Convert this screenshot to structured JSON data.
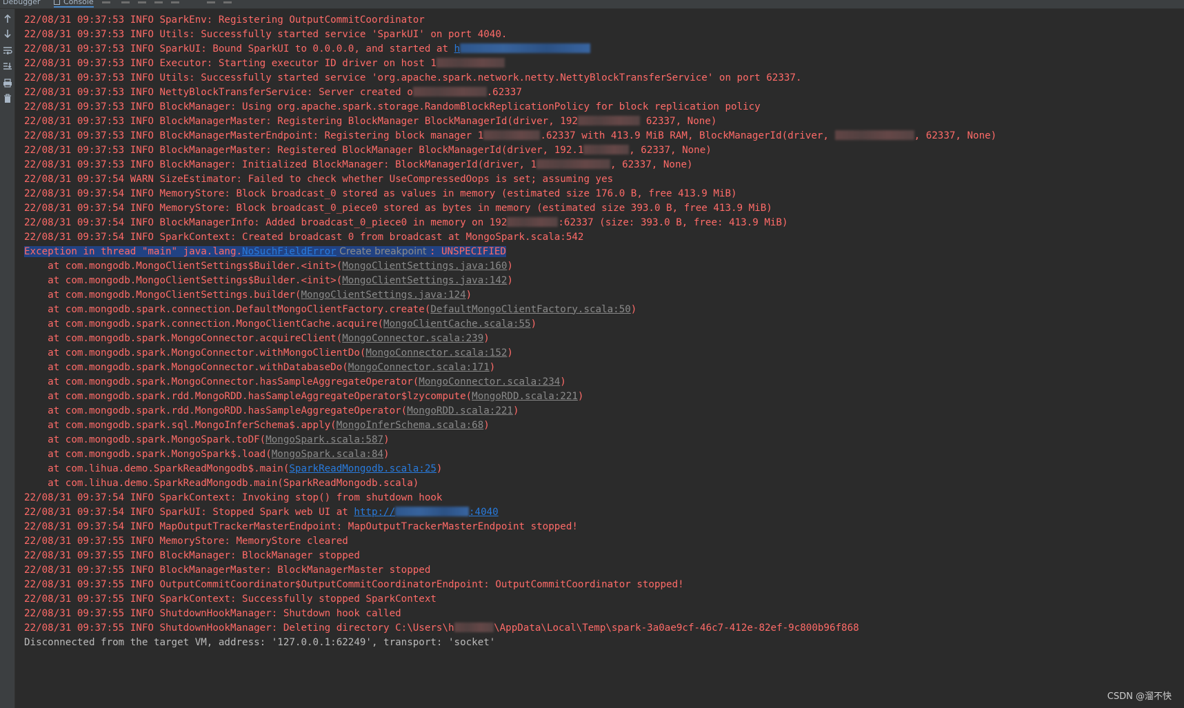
{
  "tabs": {
    "debugger": "Debugger",
    "console": "Console"
  },
  "lines": [
    {
      "parts": [
        {
          "t": "22/08/31 09:37:53 INFO SparkEnv: Registering OutputCommitCoordinator"
        }
      ]
    },
    {
      "parts": [
        {
          "t": "22/08/31 09:37:53 INFO Utils: Successfully started service 'SparkUI' on port 4040."
        }
      ]
    },
    {
      "parts": [
        {
          "t": "22/08/31 09:37:53 INFO SparkUI: Bound SparkUI to 0.0.0.0, and started at "
        },
        {
          "t": "h",
          "link": "blue"
        },
        {
          "blur": 23,
          "kind": "bluelink"
        }
      ]
    },
    {
      "parts": [
        {
          "t": "22/08/31 09:37:53 INFO Executor: Starting executor ID driver on host 1"
        },
        {
          "blur": 12
        }
      ]
    },
    {
      "parts": [
        {
          "t": "22/08/31 09:37:53 INFO Utils: Successfully started service 'org.apache.spark.network.netty.NettyBlockTransferService' on port 62337."
        }
      ]
    },
    {
      "parts": [
        {
          "t": "22/08/31 09:37:53 INFO NettyBlockTransferService: Server created o"
        },
        {
          "blur": 13
        },
        {
          "t": ".62337"
        }
      ]
    },
    {
      "parts": [
        {
          "t": "22/08/31 09:37:53 INFO BlockManager: Using org.apache.spark.storage.RandomBlockReplicationPolicy for block replication policy"
        }
      ]
    },
    {
      "parts": [
        {
          "t": "22/08/31 09:37:53 INFO BlockManagerMaster: Registering BlockManager BlockManagerId(driver, 192"
        },
        {
          "blur": 11
        },
        {
          "t": " 62337, None)"
        }
      ]
    },
    {
      "parts": [
        {
          "t": "22/08/31 09:37:53 INFO BlockManagerMasterEndpoint: Registering block manager 1"
        },
        {
          "blur": 10
        },
        {
          "t": ".62337 with 413.9 MiB RAM, BlockManagerId(driver, "
        },
        {
          "blur": 14
        },
        {
          "t": ", 62337, None)"
        }
      ]
    },
    {
      "parts": [
        {
          "t": "22/08/31 09:37:53 INFO BlockManagerMaster: Registered BlockManager BlockManagerId(driver, 192.1"
        },
        {
          "blur": 8
        },
        {
          "t": ", 62337, None)"
        }
      ]
    },
    {
      "parts": [
        {
          "t": "22/08/31 09:37:53 INFO BlockManager: Initialized BlockManager: BlockManagerId(driver, 1"
        },
        {
          "blur": 13
        },
        {
          "t": ", 62337, None)"
        }
      ]
    },
    {
      "parts": [
        {
          "t": "22/08/31 09:37:54 WARN SizeEstimator: Failed to check whether UseCompressedOops is set; assuming yes"
        }
      ]
    },
    {
      "parts": [
        {
          "t": "22/08/31 09:37:54 INFO MemoryStore: Block broadcast_0 stored as values in memory (estimated size 176.0 B, free 413.9 MiB)"
        }
      ]
    },
    {
      "parts": [
        {
          "t": "22/08/31 09:37:54 INFO MemoryStore: Block broadcast_0_piece0 stored as bytes in memory (estimated size 393.0 B, free 413.9 MiB)"
        }
      ]
    },
    {
      "parts": [
        {
          "t": "22/08/31 09:37:54 INFO BlockManagerInfo: Added broadcast_0_piece0 in memory on 192"
        },
        {
          "blur": 9
        },
        {
          "t": ":62337 (size: 393.0 B, free: 413.9 MiB)"
        }
      ]
    },
    {
      "parts": [
        {
          "t": "22/08/31 09:37:54 INFO SparkContext: Created broadcast 0 from broadcast at MongoSpark.scala:542"
        }
      ]
    },
    {
      "selected": true,
      "parts": [
        {
          "t": "Exception in thread \"main\" java.lang."
        },
        {
          "t": "NoSuchFieldError",
          "link": "blue"
        },
        {
          "t": " Create breakpoint ",
          "hint": true
        },
        {
          "t": ": UNSPECIFIED"
        }
      ]
    },
    {
      "parts": [
        {
          "t": "    at com.mongodb.MongoClientSettings$Builder.<init>("
        },
        {
          "t": "MongoClientSettings.java:160",
          "link": "grey"
        },
        {
          "t": ")"
        }
      ]
    },
    {
      "parts": [
        {
          "t": "    at com.mongodb.MongoClientSettings$Builder.<init>("
        },
        {
          "t": "MongoClientSettings.java:142",
          "link": "grey"
        },
        {
          "t": ")"
        }
      ]
    },
    {
      "parts": [
        {
          "t": "    at com.mongodb.MongoClientSettings.builder("
        },
        {
          "t": "MongoClientSettings.java:124",
          "link": "grey"
        },
        {
          "t": ")"
        }
      ]
    },
    {
      "parts": [
        {
          "t": "    at com.mongodb.spark.connection.DefaultMongoClientFactory.create("
        },
        {
          "t": "DefaultMongoClientFactory.scala:50",
          "link": "grey"
        },
        {
          "t": ")"
        }
      ]
    },
    {
      "parts": [
        {
          "t": "    at com.mongodb.spark.connection.MongoClientCache.acquire("
        },
        {
          "t": "MongoClientCache.scala:55",
          "link": "grey"
        },
        {
          "t": ")"
        }
      ]
    },
    {
      "parts": [
        {
          "t": "    at com.mongodb.spark.MongoConnector.acquireClient("
        },
        {
          "t": "MongoConnector.scala:239",
          "link": "grey"
        },
        {
          "t": ")"
        }
      ]
    },
    {
      "parts": [
        {
          "t": "    at com.mongodb.spark.MongoConnector.withMongoClientDo("
        },
        {
          "t": "MongoConnector.scala:152",
          "link": "grey"
        },
        {
          "t": ")"
        }
      ]
    },
    {
      "parts": [
        {
          "t": "    at com.mongodb.spark.MongoConnector.withDatabaseDo("
        },
        {
          "t": "MongoConnector.scala:171",
          "link": "grey"
        },
        {
          "t": ")"
        }
      ]
    },
    {
      "parts": [
        {
          "t": "    at com.mongodb.spark.MongoConnector.hasSampleAggregateOperator("
        },
        {
          "t": "MongoConnector.scala:234",
          "link": "grey"
        },
        {
          "t": ")"
        }
      ]
    },
    {
      "parts": [
        {
          "t": "    at com.mongodb.spark.rdd.MongoRDD.hasSampleAggregateOperator$lzycompute("
        },
        {
          "t": "MongoRDD.scala:221",
          "link": "grey"
        },
        {
          "t": ")"
        }
      ]
    },
    {
      "parts": [
        {
          "t": "    at com.mongodb.spark.rdd.MongoRDD.hasSampleAggregateOperator("
        },
        {
          "t": "MongoRDD.scala:221",
          "link": "grey"
        },
        {
          "t": ")"
        }
      ]
    },
    {
      "parts": [
        {
          "t": "    at com.mongodb.spark.sql.MongoInferSchema$.apply("
        },
        {
          "t": "MongoInferSchema.scala:68",
          "link": "grey"
        },
        {
          "t": ")"
        }
      ]
    },
    {
      "parts": [
        {
          "t": "    at com.mongodb.spark.MongoSpark.toDF("
        },
        {
          "t": "MongoSpark.scala:587",
          "link": "grey"
        },
        {
          "t": ")"
        }
      ]
    },
    {
      "parts": [
        {
          "t": "    at com.mongodb.spark.MongoSpark$.load("
        },
        {
          "t": "MongoSpark.scala:84",
          "link": "grey"
        },
        {
          "t": ")"
        }
      ]
    },
    {
      "parts": [
        {
          "t": "    at com.lihua.demo.SparkReadMongodb$.main("
        },
        {
          "t": "SparkReadMongodb.scala:25",
          "link": "blue"
        },
        {
          "t": ")"
        }
      ]
    },
    {
      "parts": [
        {
          "t": "    at com.lihua.demo.SparkReadMongodb.main(SparkReadMongodb.scala)"
        }
      ]
    },
    {
      "parts": [
        {
          "t": "22/08/31 09:37:54 INFO SparkContext: Invoking stop() from shutdown hook"
        }
      ]
    },
    {
      "parts": [
        {
          "t": "22/08/31 09:37:54 INFO SparkUI: Stopped Spark web UI at "
        },
        {
          "t": "http://",
          "link": "blue"
        },
        {
          "blur": 13,
          "kind": "bluelink"
        },
        {
          "t": ":4040",
          "link": "blue"
        }
      ]
    },
    {
      "parts": [
        {
          "t": "22/08/31 09:37:54 INFO MapOutputTrackerMasterEndpoint: MapOutputTrackerMasterEndpoint stopped!"
        }
      ]
    },
    {
      "parts": [
        {
          "t": "22/08/31 09:37:55 INFO MemoryStore: MemoryStore cleared"
        }
      ]
    },
    {
      "parts": [
        {
          "t": "22/08/31 09:37:55 INFO BlockManager: BlockManager stopped"
        }
      ]
    },
    {
      "parts": [
        {
          "t": "22/08/31 09:37:55 INFO BlockManagerMaster: BlockManagerMaster stopped"
        }
      ]
    },
    {
      "parts": [
        {
          "t": "22/08/31 09:37:55 INFO OutputCommitCoordinator$OutputCommitCoordinatorEndpoint: OutputCommitCoordinator stopped!"
        }
      ]
    },
    {
      "parts": [
        {
          "t": "22/08/31 09:37:55 INFO SparkContext: Successfully stopped SparkContext"
        }
      ]
    },
    {
      "parts": [
        {
          "t": "22/08/31 09:37:55 INFO ShutdownHookManager: Shutdown hook called"
        }
      ]
    },
    {
      "parts": [
        {
          "t": "22/08/31 09:37:55 INFO ShutdownHookManager: Deleting directory C:\\Users\\h"
        },
        {
          "blur": 7
        },
        {
          "t": "\\AppData\\Local\\Temp\\spark-3a0ae9cf-46c7-412e-82ef-9c800b96f868"
        }
      ]
    },
    {
      "plain": true,
      "parts": [
        {
          "t": "Disconnected from the target VM, address: '127.0.0.1:62249', transport: 'socket'"
        }
      ]
    }
  ],
  "watermark": "CSDN @溜不快",
  "colors": {
    "error_text": "#ff6b68",
    "plain_text": "#bbbbbb",
    "background": "#2b2b2b",
    "selection": "#214283",
    "link_blue": "#287bde"
  },
  "toolbar_icons": [
    "arrow-up-icon",
    "arrow-down-icon",
    "soft-wrap-icon",
    "scroll-to-end-icon",
    "print-icon",
    "trash-icon"
  ]
}
